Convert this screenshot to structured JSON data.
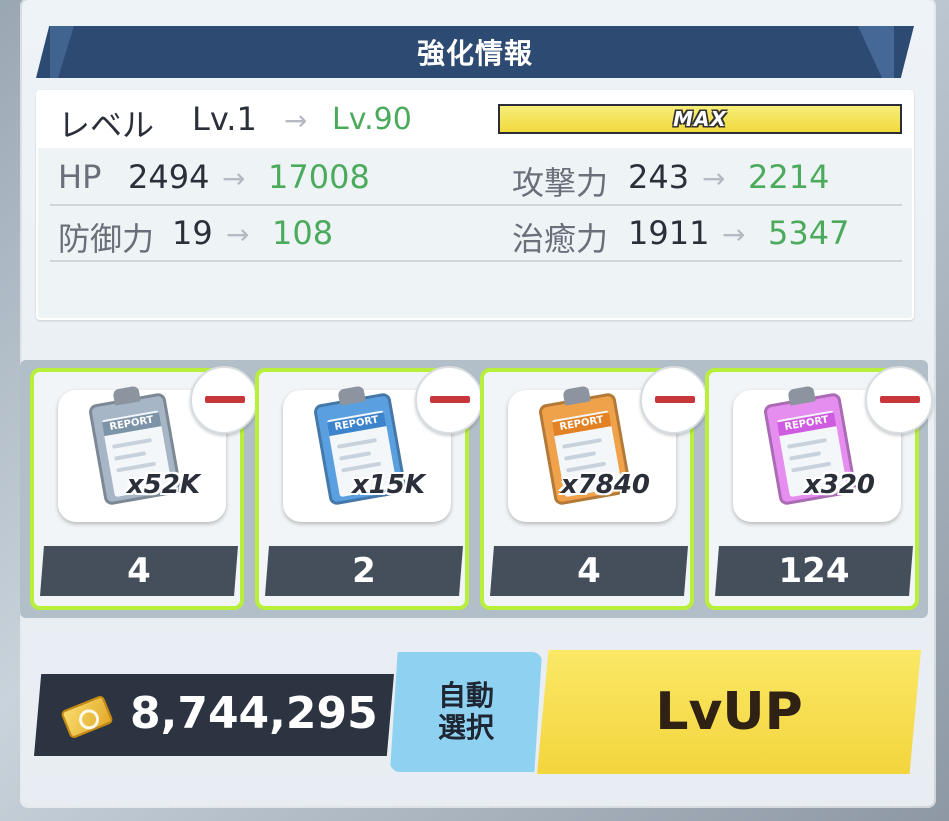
{
  "header": {
    "title": "強化情報"
  },
  "level": {
    "label": "レベル",
    "current": "Lv.1",
    "arrow": "→",
    "target": "Lv.90",
    "max_label": "MAX"
  },
  "stats": [
    {
      "label": "HP",
      "current": "2494",
      "arrow": "→",
      "target": "17008"
    },
    {
      "label": "攻撃力",
      "current": "243",
      "arrow": "→",
      "target": "2214"
    },
    {
      "label": "防御力",
      "current": "19",
      "arrow": "→",
      "target": "108"
    },
    {
      "label": "治癒力",
      "current": "1911",
      "arrow": "→",
      "target": "5347"
    }
  ],
  "items": [
    {
      "icon": "report-gray-icon",
      "report_label": "REPORT",
      "owned": "x52K",
      "selected": "4",
      "color": "#a6b6c6"
    },
    {
      "icon": "report-blue-icon",
      "report_label": "REPORT",
      "owned": "x15K",
      "selected": "2",
      "color": "#5aa0e0"
    },
    {
      "icon": "report-orange-icon",
      "report_label": "REPORT",
      "owned": "x7840",
      "selected": "4",
      "color": "#f0a24a"
    },
    {
      "icon": "report-purple-icon",
      "report_label": "REPORT",
      "owned": "x320",
      "selected": "124",
      "color": "#e58ef0"
    }
  ],
  "footer": {
    "credits": "8,744,295",
    "auto_select_line1": "自動",
    "auto_select_line2": "選択",
    "lvup_label": "LvUP"
  },
  "colors": {
    "accent_green": "#4caa5c",
    "card_border": "#b8ef3a",
    "title_bar": "#2d4a72",
    "lvup": "#f3d53d",
    "auto_select": "#8fd1f1"
  }
}
